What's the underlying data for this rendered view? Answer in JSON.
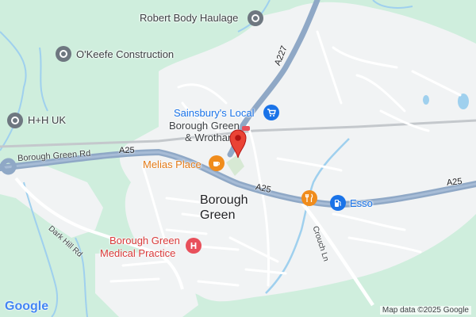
{
  "map": {
    "colors": {
      "green": "#cfeedd",
      "urban": "#f1f3f4",
      "major_road": "#8fa8c6",
      "minor_road": "#ffffff",
      "rail": "#c4c8cc",
      "water": "#9fd0ee",
      "poi_gray": "#6e7780",
      "shopping_blue": "#1a73e8",
      "food_orange": "#f08c1c",
      "medical_red": "#e8505b",
      "marker_red": "#ea4335"
    },
    "places": {
      "town_line1": "Borough",
      "town_line2": "Green"
    },
    "pois": {
      "haulage": "Robert Body Haulage",
      "construction": "O'Keefe Construction",
      "hh": "H+H UK",
      "sainsburys": "Sainsbury's Local",
      "station_line1": "Borough Green",
      "station_line2": "& Wrotham",
      "melias": "Melias Place",
      "esso": "Esso",
      "medical_line1": "Borough Green",
      "medical_line2": "Medical Practice"
    },
    "roads": {
      "a227": "A227",
      "a25_west": "A25",
      "a25_mid": "A25",
      "a25_east": "A25",
      "borough_green_rd": "Borough Green Rd",
      "dark_hill_rd": "Dark Hill Rd",
      "crouch_ln": "Crouch Ln"
    },
    "icons": {
      "poi": "location-pin-icon",
      "shopping": "shopping-cart-icon",
      "station": "train-icon",
      "cafe": "coffee-cup-icon",
      "restaurant": "fork-knife-icon",
      "fuel": "gas-pump-icon",
      "hospital": "hospital-h-icon",
      "marker": "red-marker-icon"
    },
    "footer": {
      "logo": "Google",
      "credit": "Map data ©2025 Google"
    }
  }
}
